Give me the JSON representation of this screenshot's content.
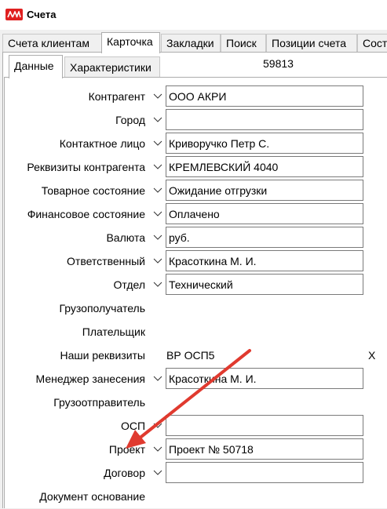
{
  "window": {
    "title": "Счета"
  },
  "tabs": [
    {
      "label": "Счета клиентам",
      "active": false
    },
    {
      "label": "Карточка",
      "active": true
    },
    {
      "label": "Закладки",
      "active": false
    },
    {
      "label": "Поиск",
      "active": false
    },
    {
      "label": "Позиции счета",
      "active": false
    },
    {
      "label": "Сост",
      "active": false
    }
  ],
  "subtabs": [
    {
      "label": "Данные",
      "active": true
    },
    {
      "label": "Характеристики",
      "active": false
    }
  ],
  "record_id": "59813",
  "form": {
    "rows": [
      {
        "label": "Контрагент",
        "value": "ООО АКРИ"
      },
      {
        "label": "Город",
        "value": ""
      },
      {
        "label": "Контактное лицо",
        "value": "Криворучко Петр С."
      },
      {
        "label": "Реквизиты контрагента",
        "value": "КРЕМЛЕВСКИЙ 4040"
      },
      {
        "label": "Товарное состояние",
        "value": "Ожидание отгрузки"
      },
      {
        "label": "Финансовое состояние",
        "value": "Оплачено"
      },
      {
        "label": "Валюта",
        "value": "руб."
      },
      {
        "label": "Ответственный",
        "value": "Красоткина М. И."
      },
      {
        "label": "Отдел",
        "value": "Технический"
      },
      {
        "label": "Грузополучатель"
      },
      {
        "label": "Плательщик"
      },
      {
        "label": "Наши реквизиты",
        "value": "ВР ОСП5",
        "clear": "X"
      },
      {
        "label": "Менеджер занесения",
        "value": "Красоткина М. И."
      },
      {
        "label": "Грузоотправитель"
      },
      {
        "label": "ОСП",
        "value": ""
      },
      {
        "label": "Проект",
        "value": "Проект № 50718"
      },
      {
        "label": "Договор",
        "value": ""
      },
      {
        "label": "Документ основание"
      }
    ]
  },
  "colors": {
    "annotation_arrow": "#e03a2f",
    "app_icon": "#e02020"
  },
  "icons": {
    "app": "app-logo-icon",
    "dropdown": "chevron-down-icon"
  }
}
